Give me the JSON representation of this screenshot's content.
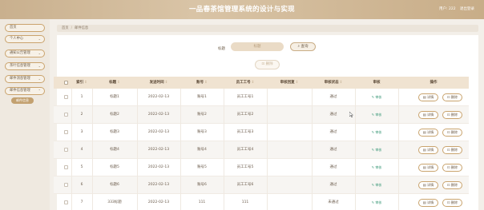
{
  "header": {
    "title": "一品春茶馆管理系统的设计与实现",
    "user_label": "用户: 222",
    "logout": "退出登录"
  },
  "sidebar": {
    "items": [
      {
        "label": "首页",
        "has_arrow": false
      },
      {
        "label": "个人中心",
        "has_arrow": true
      },
      {
        "label": "通知公告管理",
        "has_arrow": true
      },
      {
        "label": "茶叶信息管理",
        "has_arrow": true
      },
      {
        "label": "邮件消息管理",
        "has_arrow": true
      },
      {
        "label": "邮件信息管理",
        "has_arrow": true
      }
    ],
    "sub_item": "邮件信息"
  },
  "breadcrumb": {
    "home": "首页",
    "current": "邮件信息"
  },
  "search": {
    "label": "标题",
    "placeholder": "标题",
    "button": "查询"
  },
  "delete_button": "删除",
  "table": {
    "headers": [
      "索引",
      "标题",
      "发送时间",
      "账号",
      "员工工号",
      "审核回复",
      "审核状态",
      "审核",
      "操作"
    ],
    "rows": [
      {
        "index": "1",
        "title": "标题1",
        "time": "2022-02-13",
        "account": "账号1",
        "emp": "员工工号1",
        "reply": "",
        "status": "通过",
        "review": "审核"
      },
      {
        "index": "2",
        "title": "标题2",
        "time": "2022-02-13",
        "account": "账号2",
        "emp": "员工工号2",
        "reply": "",
        "status": "通过",
        "review": "审核"
      },
      {
        "index": "3",
        "title": "标题3",
        "time": "2022-02-13",
        "account": "账号3",
        "emp": "员工工号3",
        "reply": "",
        "status": "通过",
        "review": "审核"
      },
      {
        "index": "4",
        "title": "标题4",
        "time": "2022-02-13",
        "account": "账号4",
        "emp": "员工工号4",
        "reply": "",
        "status": "通过",
        "review": "审核"
      },
      {
        "index": "5",
        "title": "标题5",
        "time": "2022-02-13",
        "account": "账号5",
        "emp": "员工工号5",
        "reply": "",
        "status": "通过",
        "review": "审核"
      },
      {
        "index": "6",
        "title": "标题6",
        "time": "2022-02-13",
        "account": "账号6",
        "emp": "员工工号6",
        "reply": "",
        "status": "通过",
        "review": "审核"
      },
      {
        "index": "7",
        "title": "333标题",
        "time": "2022-02-13",
        "account": "111",
        "emp": "111",
        "reply": "",
        "status": "未通过",
        "review": "审核"
      }
    ],
    "detail_label": "详情",
    "delete_label": "删除"
  },
  "colors": {
    "topbar": "#c9b08e",
    "accent": "#c3a170",
    "header_row": "#f0e3d1",
    "link": "#3e9a7a"
  }
}
